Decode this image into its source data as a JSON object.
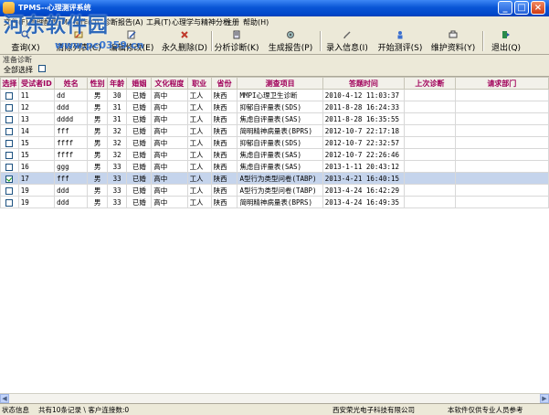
{
  "window": {
    "title": "TPMS--心理测评系统"
  },
  "menu": [
    "文件(F)",
    "管理配置(M)",
    "操作(O)",
    "诊断报告(A)",
    "工具(T)",
    "心理学与精神分析",
    "注册",
    "帮助(H)"
  ],
  "toolbar": [
    {
      "label": "查询(X)",
      "icon": "search-icon"
    },
    {
      "label": "清除列表(C)",
      "icon": "clear-icon"
    },
    {
      "label": "编辑修改(E)",
      "icon": "edit-icon"
    },
    {
      "label": "永久删除(D)",
      "icon": "delete-icon"
    },
    {
      "label": "分析诊断(K)",
      "icon": "analyze-icon"
    },
    {
      "label": "生成报告(P)",
      "icon": "report-icon"
    },
    {
      "label": "录入信息(I)",
      "icon": "input-icon"
    },
    {
      "label": "开始测评(S)",
      "icon": "test-icon"
    },
    {
      "label": "维护资料(Y)",
      "icon": "maintain-icon"
    },
    {
      "label": "退出(Q)",
      "icon": "exit-icon"
    }
  ],
  "watermark": {
    "title": "河东软件园",
    "url": "www.pc0359.cn"
  },
  "panel": {
    "label": "准备诊断",
    "select_all": "全部选择"
  },
  "table": {
    "headers": [
      "选择",
      "受试者ID",
      "姓名",
      "性别",
      "年龄",
      "婚姻",
      "文化程度",
      "职业",
      "省份",
      "测查项目",
      "答题时间",
      "上次诊断",
      "请求部门"
    ],
    "rows": [
      {
        "checked": false,
        "cells": [
          "11",
          "dd",
          "男",
          "30",
          "已婚",
          "高中",
          "工人",
          "陕西",
          "MMPI心理卫生诊断",
          "2010-4-12 11:03:37",
          "",
          ""
        ]
      },
      {
        "checked": false,
        "cells": [
          "12",
          "ddd",
          "男",
          "31",
          "已婚",
          "高中",
          "工人",
          "陕西",
          "抑郁自评量表(SDS)",
          "2011-8-28 16:24:33",
          "",
          ""
        ]
      },
      {
        "checked": false,
        "cells": [
          "13",
          "dddd",
          "男",
          "31",
          "已婚",
          "高中",
          "工人",
          "陕西",
          "焦虑自评量表(SAS)",
          "2011-8-28 16:35:55",
          "",
          ""
        ]
      },
      {
        "checked": false,
        "cells": [
          "14",
          "fff",
          "男",
          "32",
          "已婚",
          "高中",
          "工人",
          "陕西",
          "简明精神病量表(BPRS)",
          "2012-10-7 22:17:18",
          "",
          ""
        ]
      },
      {
        "checked": false,
        "cells": [
          "15",
          "ffff",
          "男",
          "32",
          "已婚",
          "高中",
          "工人",
          "陕西",
          "抑郁自评量表(SDS)",
          "2012-10-7 22:32:57",
          "",
          ""
        ]
      },
      {
        "checked": false,
        "cells": [
          "15",
          "ffff",
          "男",
          "32",
          "已婚",
          "高中",
          "工人",
          "陕西",
          "焦虑自评量表(SAS)",
          "2012-10-7 22:26:46",
          "",
          ""
        ]
      },
      {
        "checked": false,
        "cells": [
          "16",
          "ggg",
          "男",
          "33",
          "已婚",
          "高中",
          "工人",
          "陕西",
          "焦虑自评量表(SAS)",
          "2013-1-11 20:43:12",
          "",
          ""
        ]
      },
      {
        "checked": true,
        "cells": [
          "17",
          "fff",
          "男",
          "33",
          "已婚",
          "高中",
          "工人",
          "陕西",
          "A型行为类型问卷(TABP)",
          "2013-4-21 16:40:15",
          "",
          ""
        ]
      },
      {
        "checked": false,
        "cells": [
          "19",
          "ddd",
          "男",
          "33",
          "已婚",
          "高中",
          "工人",
          "陕西",
          "A型行为类型问卷(TABP)",
          "2013-4-24 16:42:29",
          "",
          ""
        ]
      },
      {
        "checked": false,
        "cells": [
          "19",
          "ddd",
          "男",
          "33",
          "已婚",
          "高中",
          "工人",
          "陕西",
          "简明精神病量表(BPRS)",
          "2013-4-24 16:49:35",
          "",
          ""
        ]
      }
    ]
  },
  "status": {
    "label": "状态信息",
    "records": "共有10条记录 \\ 客户连接数:0",
    "company": "西安荣光电子科技有限公司",
    "note": "本软件仅供专业人员参考"
  }
}
